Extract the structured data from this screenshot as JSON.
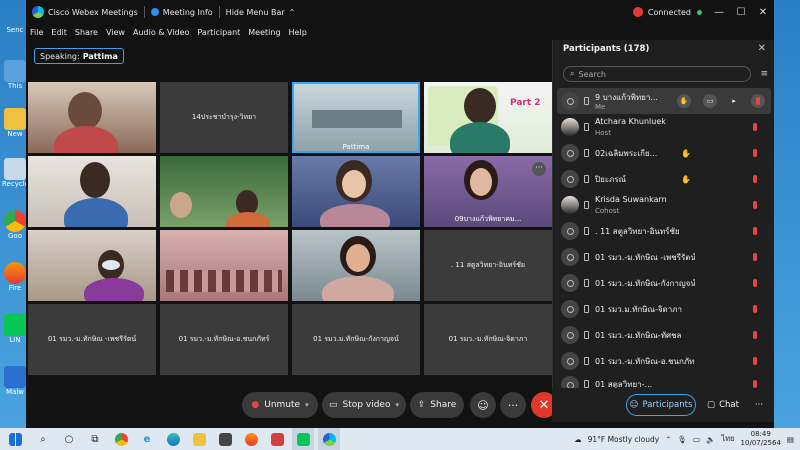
{
  "window": {
    "app_title": "Cisco Webex Meetings",
    "meeting_info": "Meeting Info",
    "hide_menu": "Hide Menu Bar",
    "connected": "Connected",
    "conn_count": "",
    "min_btn": "—",
    "max_btn": "☐",
    "close_btn": "✕"
  },
  "menu": [
    "File",
    "Edit",
    "Share",
    "View",
    "Audio & Video",
    "Participant",
    "Meeting",
    "Help"
  ],
  "speaking": {
    "label": "Speaking:",
    "name": "Pattima"
  },
  "tiles": [
    {
      "name": "",
      "caption": ""
    },
    {
      "name": "14ประชาบำรุง-วิทยา",
      "caption": ""
    },
    {
      "name": "",
      "caption": "Pattima"
    },
    {
      "name": "",
      "caption": "",
      "slide_text": "Part 2"
    },
    {
      "name": "",
      "caption": ""
    },
    {
      "name": "",
      "caption": ""
    },
    {
      "name": "",
      "caption": ""
    },
    {
      "name": "",
      "caption": "09บางแก้วพิทยาคม..."
    },
    {
      "name": "",
      "caption": ""
    },
    {
      "name": "",
      "caption": ""
    },
    {
      "name": "",
      "caption": ""
    },
    {
      "name": ". 11 สตูลวิทยา-อินทร์ชัย",
      "caption": ""
    },
    {
      "name": "01 รมว.-ม.ทักษิณ -เพชรีรัตน์",
      "caption": ""
    },
    {
      "name": "01 รมว.-ม.ทักษิณ-อ.ชนกภัทร์",
      "caption": ""
    },
    {
      "name": "01 รมว.ม.ทักษิณ-กังกาญจน์",
      "caption": ""
    },
    {
      "name": "01 รมว.-ม.ทักษิณ-จิดาภา",
      "caption": ""
    }
  ],
  "controls": {
    "unmute": "Unmute",
    "stop_video": "Stop video",
    "share": "Share",
    "reactions_icon": "☺",
    "more_icon": "···",
    "end_icon": "✕"
  },
  "panel": {
    "title": "Participants (178)",
    "close": "✕",
    "search_placeholder": "Search",
    "participants": [
      {
        "name": "9 บางแก้วพิทยา...",
        "role": "Me"
      },
      {
        "name": "Atchara Khunluek",
        "role": "Host"
      },
      {
        "name": "02เฉลิมพระเกีย...",
        "role": ""
      },
      {
        "name": "ปิยะภรณ์",
        "role": ""
      },
      {
        "name": "Krisda Suwankarn",
        "role": "Cohost"
      },
      {
        "name": ". 11 สตูลวิทยา-อินทร์ชัย",
        "role": ""
      },
      {
        "name": "01 รมว.-ม.ทักษิณ -เพชรีรัตน์",
        "role": ""
      },
      {
        "name": "01 รมว.-ม.ทักษิณ-กังกาญจน์",
        "role": ""
      },
      {
        "name": "01 รมว.ม.ทักษิณ-จิดาภา",
        "role": ""
      },
      {
        "name": "01 รมว.-ม.ทักษิณ-ทัศชล",
        "role": ""
      },
      {
        "name": "01 รมว.-ม.ทักษิณ-อ.ชนกภัทร์",
        "role": ""
      },
      {
        "name": "01 สตูลวิทยา-...",
        "role": ""
      }
    ],
    "footer_participants": "Participants",
    "footer_chat": "Chat",
    "footer_more": "···"
  },
  "desktop_labels": [
    "Senc",
    "This",
    "New",
    "Recycle",
    "Goo",
    "Fire",
    "LIN",
    "Malw"
  ],
  "taskbar": {
    "weather": "91°F  Mostly cloudy",
    "lang": "ไทย",
    "time": "08:49",
    "date": "10/07/2564"
  },
  "colors": {
    "accent": "#3aa7f0",
    "mute_red": "#e64545",
    "end_red": "#e0392b"
  }
}
